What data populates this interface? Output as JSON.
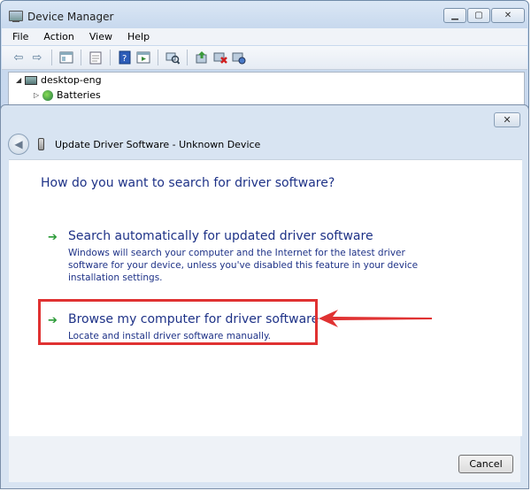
{
  "main_window": {
    "title": "Device Manager",
    "menu": [
      "File",
      "Action",
      "View",
      "Help"
    ],
    "toolbar_icons": [
      "back-icon",
      "forward-icon",
      "show-hide-icon",
      "properties-icon",
      "help-icon",
      "view-icon",
      "scan-hardware-icon",
      "update-driver-icon",
      "uninstall-icon",
      "enable-icon"
    ],
    "tree": {
      "root": "desktop-eng",
      "child": "Batteries"
    }
  },
  "dialog": {
    "close_glyph": "✕",
    "title": "Update Driver Software - Unknown Device",
    "question": "How do you want to search for driver software?",
    "options": [
      {
        "title": "Search automatically for updated driver software",
        "description": "Windows will search your computer and the Internet for the latest driver software for your device, unless you've disabled this feature in your device installation settings."
      },
      {
        "title": "Browse my computer for driver software",
        "description": "Locate and install driver software manually."
      }
    ],
    "cancel_label": "Cancel"
  },
  "colors": {
    "link_blue": "#1e3287",
    "green_arrow": "#2a9a36",
    "annotation_red": "#e03232"
  }
}
